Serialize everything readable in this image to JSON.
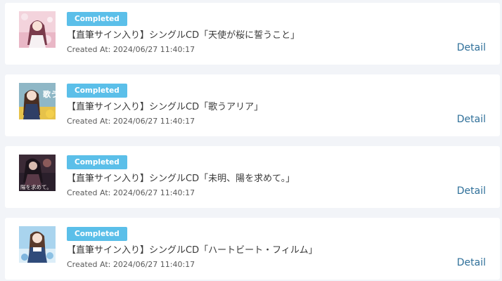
{
  "orders": [
    {
      "status": "Completed",
      "title": "【直筆サイン入り】シングルCD「天使が桜に誓うこと」",
      "created": "Created At: 2024/06/27 11:40:17",
      "detail_label": "Detail",
      "thumbnail_icon": "album-cover-pink-cherry-blossom"
    },
    {
      "status": "Completed",
      "title": "【直筆サイン入り】シングルCD「歌うアリア」",
      "created": "Created At: 2024/06/27 11:40:17",
      "detail_label": "Detail",
      "thumbnail_icon": "album-cover-aria-sunflower",
      "thumbnail_text": "歌う"
    },
    {
      "status": "Completed",
      "title": "【直筆サイン入り】シングルCD「未明、陽を求めて。」",
      "created": "Created At: 2024/06/27 11:40:17",
      "detail_label": "Detail",
      "thumbnail_icon": "album-cover-dark-night",
      "thumbnail_text": "陽を求めて。"
    },
    {
      "status": "Completed",
      "title": "【直筆サイン入り】シングルCD「ハートビート・フィルム」",
      "created": "Created At: 2024/06/27 11:40:17",
      "detail_label": "Detail",
      "thumbnail_icon": "album-cover-blue-sky"
    }
  ],
  "colors": {
    "badge": "#5bbfe9",
    "detail_link": "#2e6f99",
    "page_background": "#f2f4f8",
    "card_background": "#ffffff"
  }
}
